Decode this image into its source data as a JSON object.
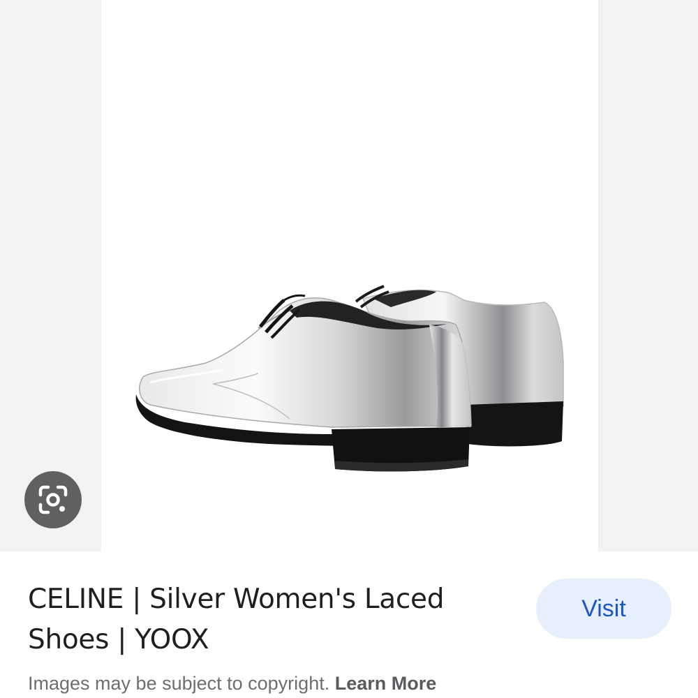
{
  "image_viewer": {
    "image_alt": "CELINE | Silver Women's Laced Shoes | YOOX",
    "lens_icon": "google-lens-icon"
  },
  "result": {
    "title": "CELINE | Silver Women's Laced Shoes | YOOX",
    "visit_label": "Visit"
  },
  "footer": {
    "copyright_text": "Images may be subject to copyright.",
    "learn_more_label": "Learn More"
  },
  "colors": {
    "viewer_background": "#f1f2f4",
    "visit_button_bg": "#e8effc",
    "visit_button_text": "#1a57c8",
    "lens_button_bg": "#5f6062"
  }
}
